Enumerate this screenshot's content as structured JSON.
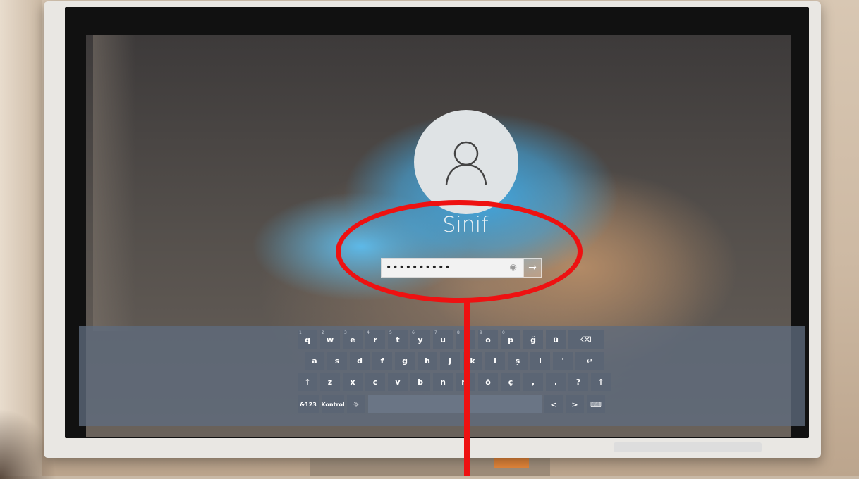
{
  "login": {
    "username": "Sinif",
    "password_masked": "••••••••••",
    "reveal_icon": "eye-icon",
    "submit_icon": "→"
  },
  "keyboard": {
    "row1": [
      {
        "key": "q",
        "alt": "1"
      },
      {
        "key": "w",
        "alt": "2"
      },
      {
        "key": "e",
        "alt": "3"
      },
      {
        "key": "r",
        "alt": "4"
      },
      {
        "key": "t",
        "alt": "5"
      },
      {
        "key": "y",
        "alt": "6"
      },
      {
        "key": "u",
        "alt": "7"
      },
      {
        "key": "ı",
        "alt": "8"
      },
      {
        "key": "o",
        "alt": "9"
      },
      {
        "key": "p",
        "alt": "0"
      },
      {
        "key": "ğ",
        "alt": ""
      },
      {
        "key": "ü",
        "alt": ""
      },
      {
        "key": "⌫",
        "alt": ""
      }
    ],
    "row2": [
      "a",
      "s",
      "d",
      "f",
      "g",
      "h",
      "j",
      "k",
      "l",
      "ş",
      "i",
      "'",
      "↵"
    ],
    "row3": [
      "↑",
      "z",
      "x",
      "c",
      "v",
      "b",
      "n",
      "m",
      "ö",
      "ç",
      ",",
      ".",
      "?",
      "↑"
    ],
    "row4": {
      "num": "&123",
      "ctrl": "Kontrol",
      "emoji": "☼",
      "left": "<",
      "right": ">",
      "kbd": "⌨"
    }
  }
}
